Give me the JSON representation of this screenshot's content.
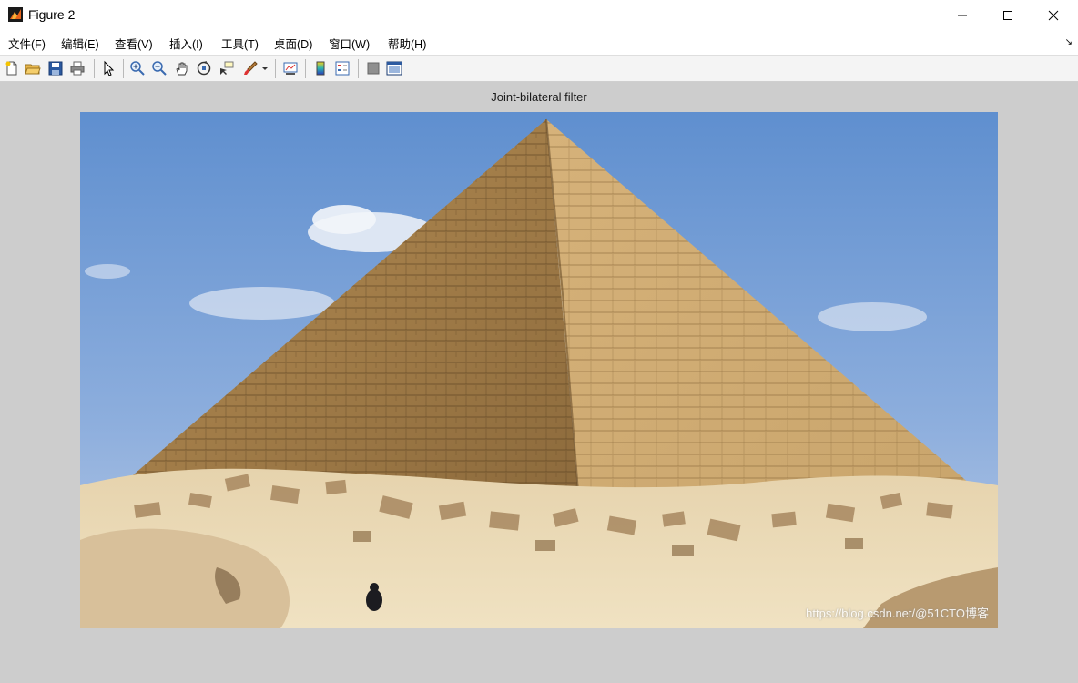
{
  "window": {
    "title": "Figure 2"
  },
  "menu": [
    {
      "label": "文件(F)"
    },
    {
      "label": "编辑(E)"
    },
    {
      "label": "查看(V)"
    },
    {
      "label": "插入(I)"
    },
    {
      "label": "工具(T)"
    },
    {
      "label": "桌面(D)"
    },
    {
      "label": "窗口(W)"
    },
    {
      "label": "帮助(H)"
    }
  ],
  "toolbar": {
    "icons": [
      "new-figure-icon",
      "open-file-icon",
      "save-icon",
      "print-icon",
      "pointer-icon",
      "zoom-in-icon",
      "zoom-out-icon",
      "pan-hand-icon",
      "rotate-3d-icon",
      "data-cursor-icon",
      "brush-icon",
      "link-plot-icon",
      "colorbar-icon",
      "legend-icon",
      "hide-plot-tools-icon",
      "show-plot-tools-icon"
    ]
  },
  "figure": {
    "axes_title": "Joint-bilateral filter"
  },
  "watermark": "https://blog.csdn.net/@51CTO博客"
}
